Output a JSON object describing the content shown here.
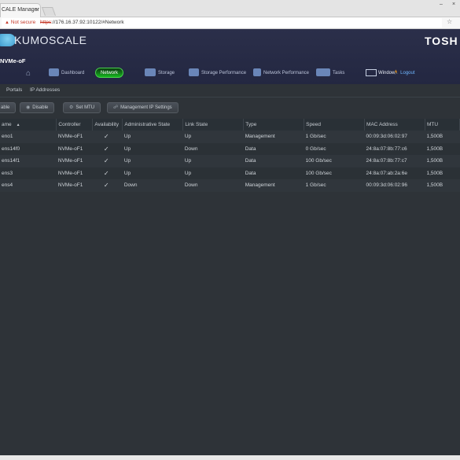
{
  "browser": {
    "tab_title": "CALE Manager",
    "tab_close": "×",
    "security_label": "Not secure",
    "url_scheme": "https",
    "url_rest": "://176.16.37.92:10122/#Network",
    "win_minimize": "–",
    "win_close": "×",
    "star": "☆"
  },
  "app": {
    "brand": "KUMOSCALE",
    "vendor": "TOSH",
    "cluster_name": "NVMe-oF",
    "nav": {
      "home": "⌂",
      "dashboard": "Dashboard",
      "network": "Network",
      "storage": "Storage",
      "storage_performance": "Storage Performance",
      "network_performance": "Network Performance",
      "tasks": "Tasks",
      "window": "Window",
      "logout": "Logout"
    },
    "subtabs": [
      "Portals",
      "IP Addresses"
    ],
    "toolbar": {
      "enable": "able",
      "disable": "Disable",
      "set_mtu": "Set MTU",
      "mgmt_ip": "Management IP Settings"
    },
    "columns": [
      "ame",
      "Controller",
      "Availability",
      "Administrative State",
      "Link State",
      "Type",
      "Speed",
      "MAC Address",
      "MTU"
    ],
    "rows": [
      {
        "name": "eno1",
        "controller": "NVMe-oF1",
        "availability": "✓",
        "admin": "Up",
        "admin_state": "up",
        "link": "Up",
        "link_state": "up",
        "type": "Management",
        "speed": "1 Gb/sec",
        "mac": "00:09:3d:06:02:97",
        "mtu": "1,500B"
      },
      {
        "name": "ens14f0",
        "controller": "NVMe-oF1",
        "availability": "✓",
        "admin": "Up",
        "admin_state": "up",
        "link": "Down",
        "link_state": "down",
        "type": "Data",
        "speed": "0 Gb/sec",
        "mac": "24:8a:07:8b:77:c6",
        "mtu": "1,500B"
      },
      {
        "name": "ens14f1",
        "controller": "NVMe-oF1",
        "availability": "✓",
        "admin": "Up",
        "admin_state": "up",
        "link": "Up",
        "link_state": "up",
        "type": "Data",
        "speed": "100 Gb/sec",
        "mac": "24:8a:07:8b:77:c7",
        "mtu": "1,500B"
      },
      {
        "name": "ens3",
        "controller": "NVMe-oF1",
        "availability": "✓",
        "admin": "Up",
        "admin_state": "up",
        "link": "Up",
        "link_state": "up",
        "type": "Data",
        "speed": "100 Gb/sec",
        "mac": "24:8a:07:ab:2a:6e",
        "mtu": "1,500B"
      },
      {
        "name": "ens4",
        "controller": "NVMe-oF1",
        "availability": "✓",
        "admin": "Down",
        "admin_state": "down",
        "link": "Down",
        "link_state": "down",
        "type": "Management",
        "speed": "1 Gb/sec",
        "mac": "00:09:3d:06:02:96",
        "mtu": "1,500B"
      }
    ]
  }
}
